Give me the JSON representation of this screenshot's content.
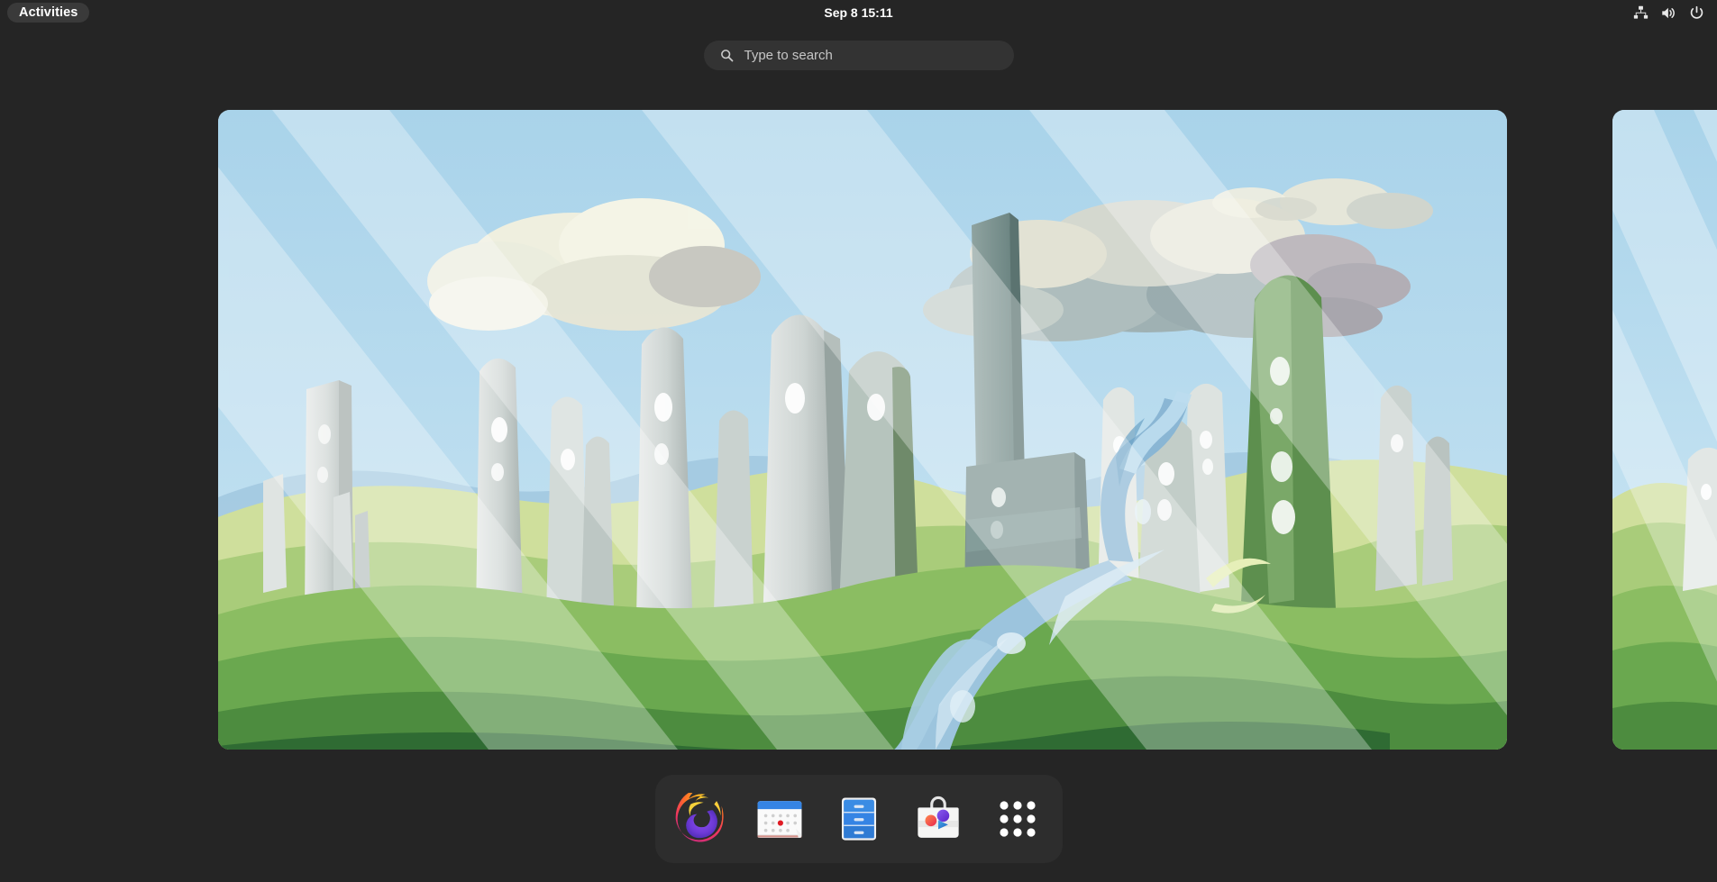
{
  "panel": {
    "activities_label": "Activities",
    "clock_label": "Sep 8  15:11",
    "indicators": [
      {
        "name": "network-wired-icon",
        "label": "Wired Network"
      },
      {
        "name": "volume-icon",
        "label": "Volume"
      },
      {
        "name": "power-icon",
        "label": "Power / System Menu"
      }
    ]
  },
  "search": {
    "placeholder": "Type to search",
    "value": "",
    "icon": "search-icon"
  },
  "overview": {
    "workspaces": [
      {
        "name": "workspace-1",
        "active": true,
        "wallpaper": "Stones"
      },
      {
        "name": "workspace-2",
        "active": false,
        "wallpaper": "Stones"
      }
    ]
  },
  "dock": {
    "items": [
      {
        "name": "firefox",
        "label": "Firefox Web Browser",
        "icon": "firefox-icon"
      },
      {
        "name": "calendar",
        "label": "Calendar",
        "icon": "calendar-icon"
      },
      {
        "name": "files",
        "label": "Files",
        "icon": "files-icon"
      },
      {
        "name": "software",
        "label": "Software",
        "icon": "software-icon"
      },
      {
        "name": "show-apps",
        "label": "Show Applications",
        "icon": "grid-icon"
      }
    ]
  },
  "colors": {
    "desktop_bg": "#252525",
    "panel_bg": "#252525",
    "dock_bg": "#2d2d2d",
    "search_bg": "#333333",
    "activities_bg": "#3a3a3a",
    "text": "#ffffff",
    "placeholder_text": "#c6c6c6",
    "accent_blue": "#3584e4",
    "firefox_orange": "#ff7139",
    "calendar_red": "#e01b24"
  }
}
